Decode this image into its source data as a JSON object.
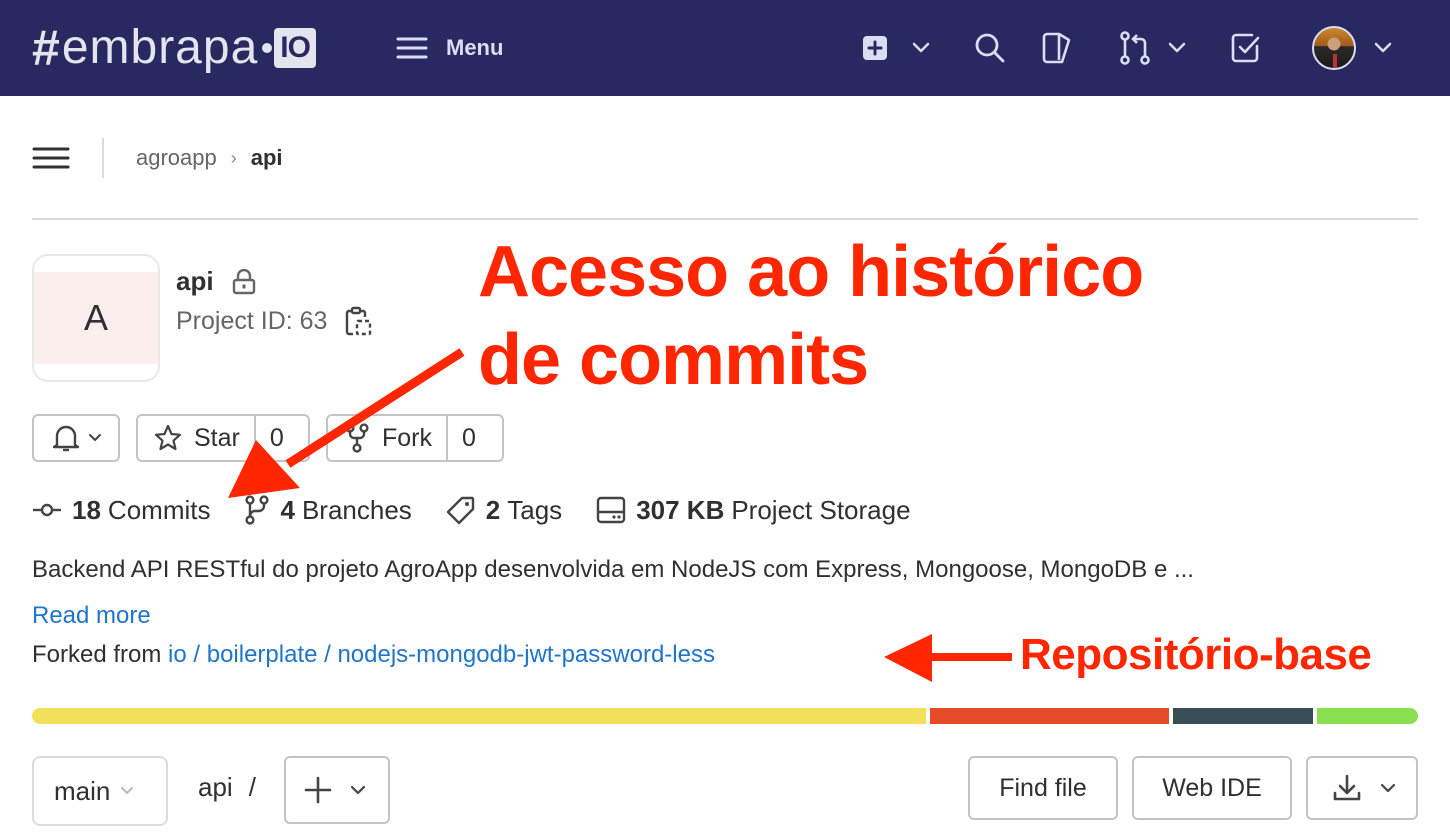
{
  "navbar": {
    "logo": {
      "hash": "#",
      "word": "embrapa",
      "badge": "IO"
    },
    "menu_label": "Menu",
    "icons": [
      "plus-square-icon",
      "search-icon",
      "issues-icon",
      "merge-request-icon",
      "todo-icon",
      "user-avatar"
    ],
    "colors": {
      "background": "#292961",
      "foreground": "#dcdcf5"
    }
  },
  "breadcrumb": {
    "items": [
      {
        "label": "agroapp"
      },
      {
        "label": "api"
      }
    ]
  },
  "project": {
    "avatar_letter": "A",
    "name": "api",
    "visibility": "private",
    "id_label": "Project ID: 63"
  },
  "actions": {
    "notifications": "bell-icon",
    "star": {
      "label": "Star",
      "count": "0"
    },
    "fork": {
      "label": "Fork",
      "count": "0"
    }
  },
  "stats": {
    "commits": {
      "count": "18",
      "label": "Commits"
    },
    "branches": {
      "count": "4",
      "label": "Branches"
    },
    "tags": {
      "count": "2",
      "label": "Tags"
    },
    "storage": {
      "count": "307 KB",
      "label": "Project Storage"
    }
  },
  "description": "Backend API RESTful do projeto AgroApp desenvolvida em NodeJS com Express, Mongoose, MongoDB e ...",
  "read_more": "Read more",
  "forked_from": {
    "prefix": "Forked from ",
    "link": "io / boilerplate / nodejs-mongodb-jwt-password-less"
  },
  "language_bar": [
    {
      "share": 64.6,
      "color": "#f1e05a"
    },
    {
      "share": 17.3,
      "color": "#e34c26"
    },
    {
      "share": 10.1,
      "color": "#384d54"
    },
    {
      "share": 7.3,
      "color": "#89e051"
    }
  ],
  "toolbar": {
    "branch": "main",
    "path_root": "api",
    "path_sep": "/",
    "find_file": "Find file",
    "web_ide": "Web IDE"
  },
  "annotations": {
    "commits_title": "Acesso ao histórico de commits",
    "commits_line1": "Acesso ao histórico",
    "commits_line2": "de commits",
    "base_repo": "Repositório-base",
    "color": "#ff2600"
  }
}
